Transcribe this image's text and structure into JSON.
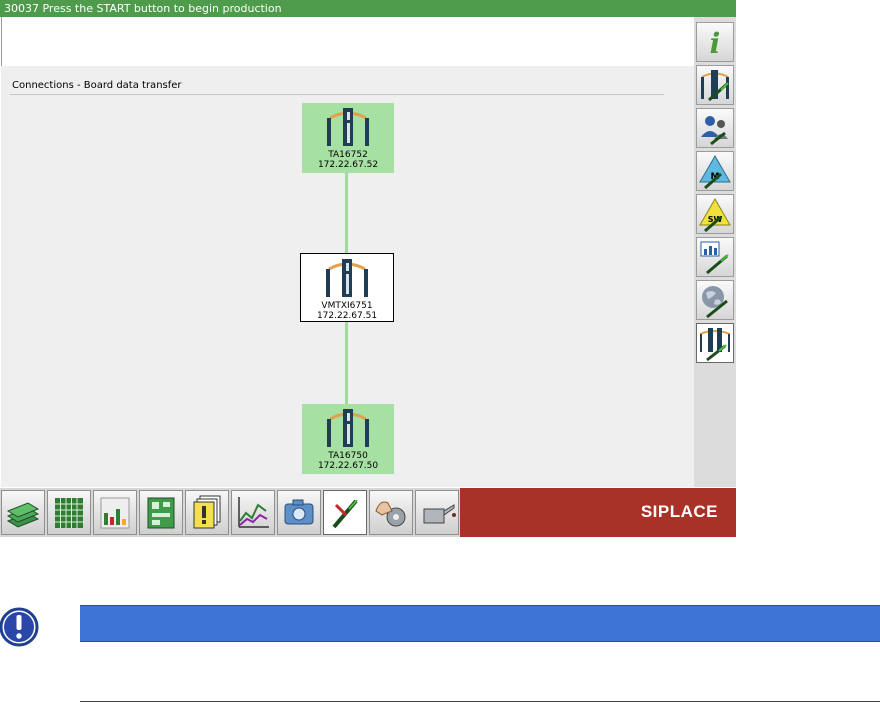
{
  "status": {
    "message": "30037 Press the START button to begin production"
  },
  "section": {
    "title": "Connections - Board data transfer"
  },
  "nodes": [
    {
      "name": "TA16752",
      "ip": "172.22.67.52",
      "state": "connected"
    },
    {
      "name": "VMTXI6751",
      "ip": "172.22.67.51",
      "state": "current"
    },
    {
      "name": "TA16750",
      "ip": "172.22.67.50",
      "state": "connected"
    }
  ],
  "right_toolbar": {
    "items": [
      {
        "icon": "info-icon",
        "glyph": "i"
      },
      {
        "icon": "machine-service-icon"
      },
      {
        "icon": "users-icon"
      },
      {
        "icon": "maintenance-warning-icon",
        "badge": "M"
      },
      {
        "icon": "software-warning-icon",
        "badge": "SW"
      },
      {
        "icon": "statistics-service-icon"
      },
      {
        "icon": "network-globe-icon"
      },
      {
        "icon": "line-connections-icon",
        "active": true
      }
    ]
  },
  "bottom_toolbar": {
    "items": [
      {
        "icon": "boards-stack-icon"
      },
      {
        "icon": "grid-table-icon"
      },
      {
        "icon": "bar-levels-icon"
      },
      {
        "icon": "pcb-layout-icon"
      },
      {
        "icon": "documents-warning-icon"
      },
      {
        "icon": "line-chart-icon"
      },
      {
        "icon": "camera-icon"
      },
      {
        "icon": "service-tools-icon",
        "active": true
      },
      {
        "icon": "hand-gear-icon"
      },
      {
        "icon": "oil-can-icon"
      }
    ]
  },
  "brand": {
    "label": "SIPLACE"
  },
  "colors": {
    "status_bar": "#4f9b4c",
    "node_connected": "#a6e0a3",
    "connection_line": "#9fdc9c",
    "brand_panel": "#a83228",
    "note_bar": "#3d74d6"
  }
}
